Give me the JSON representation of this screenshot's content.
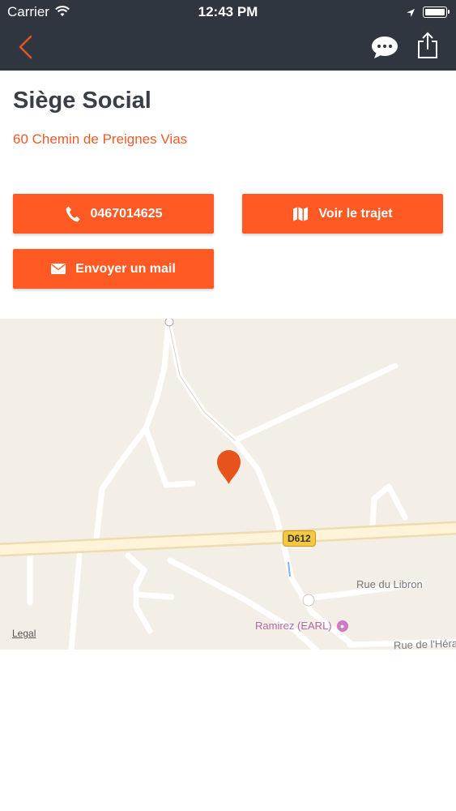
{
  "status_bar": {
    "carrier": "Carrier",
    "time": "12:43 PM"
  },
  "nav": {
    "back_icon": "chevron-left-icon",
    "chat_icon": "chat-bubble-icon",
    "share_icon": "share-icon",
    "back_color": "#e0542a"
  },
  "place": {
    "title": "Siège Social",
    "address": "60 Chemin de Preignes Vias"
  },
  "actions": {
    "phone_label": "0467014625",
    "route_label": "Voir le trajet",
    "mail_label": "Envoyer un mail",
    "button_color": "#ff5a24"
  },
  "map": {
    "road_shield": "D612",
    "road_label_1": "Rue du Libron",
    "road_label_2": "Rue de l'Héra",
    "poi_label": "Ramirez (EARL)",
    "legal_label": "Legal",
    "pin_color": "#e8521c"
  }
}
